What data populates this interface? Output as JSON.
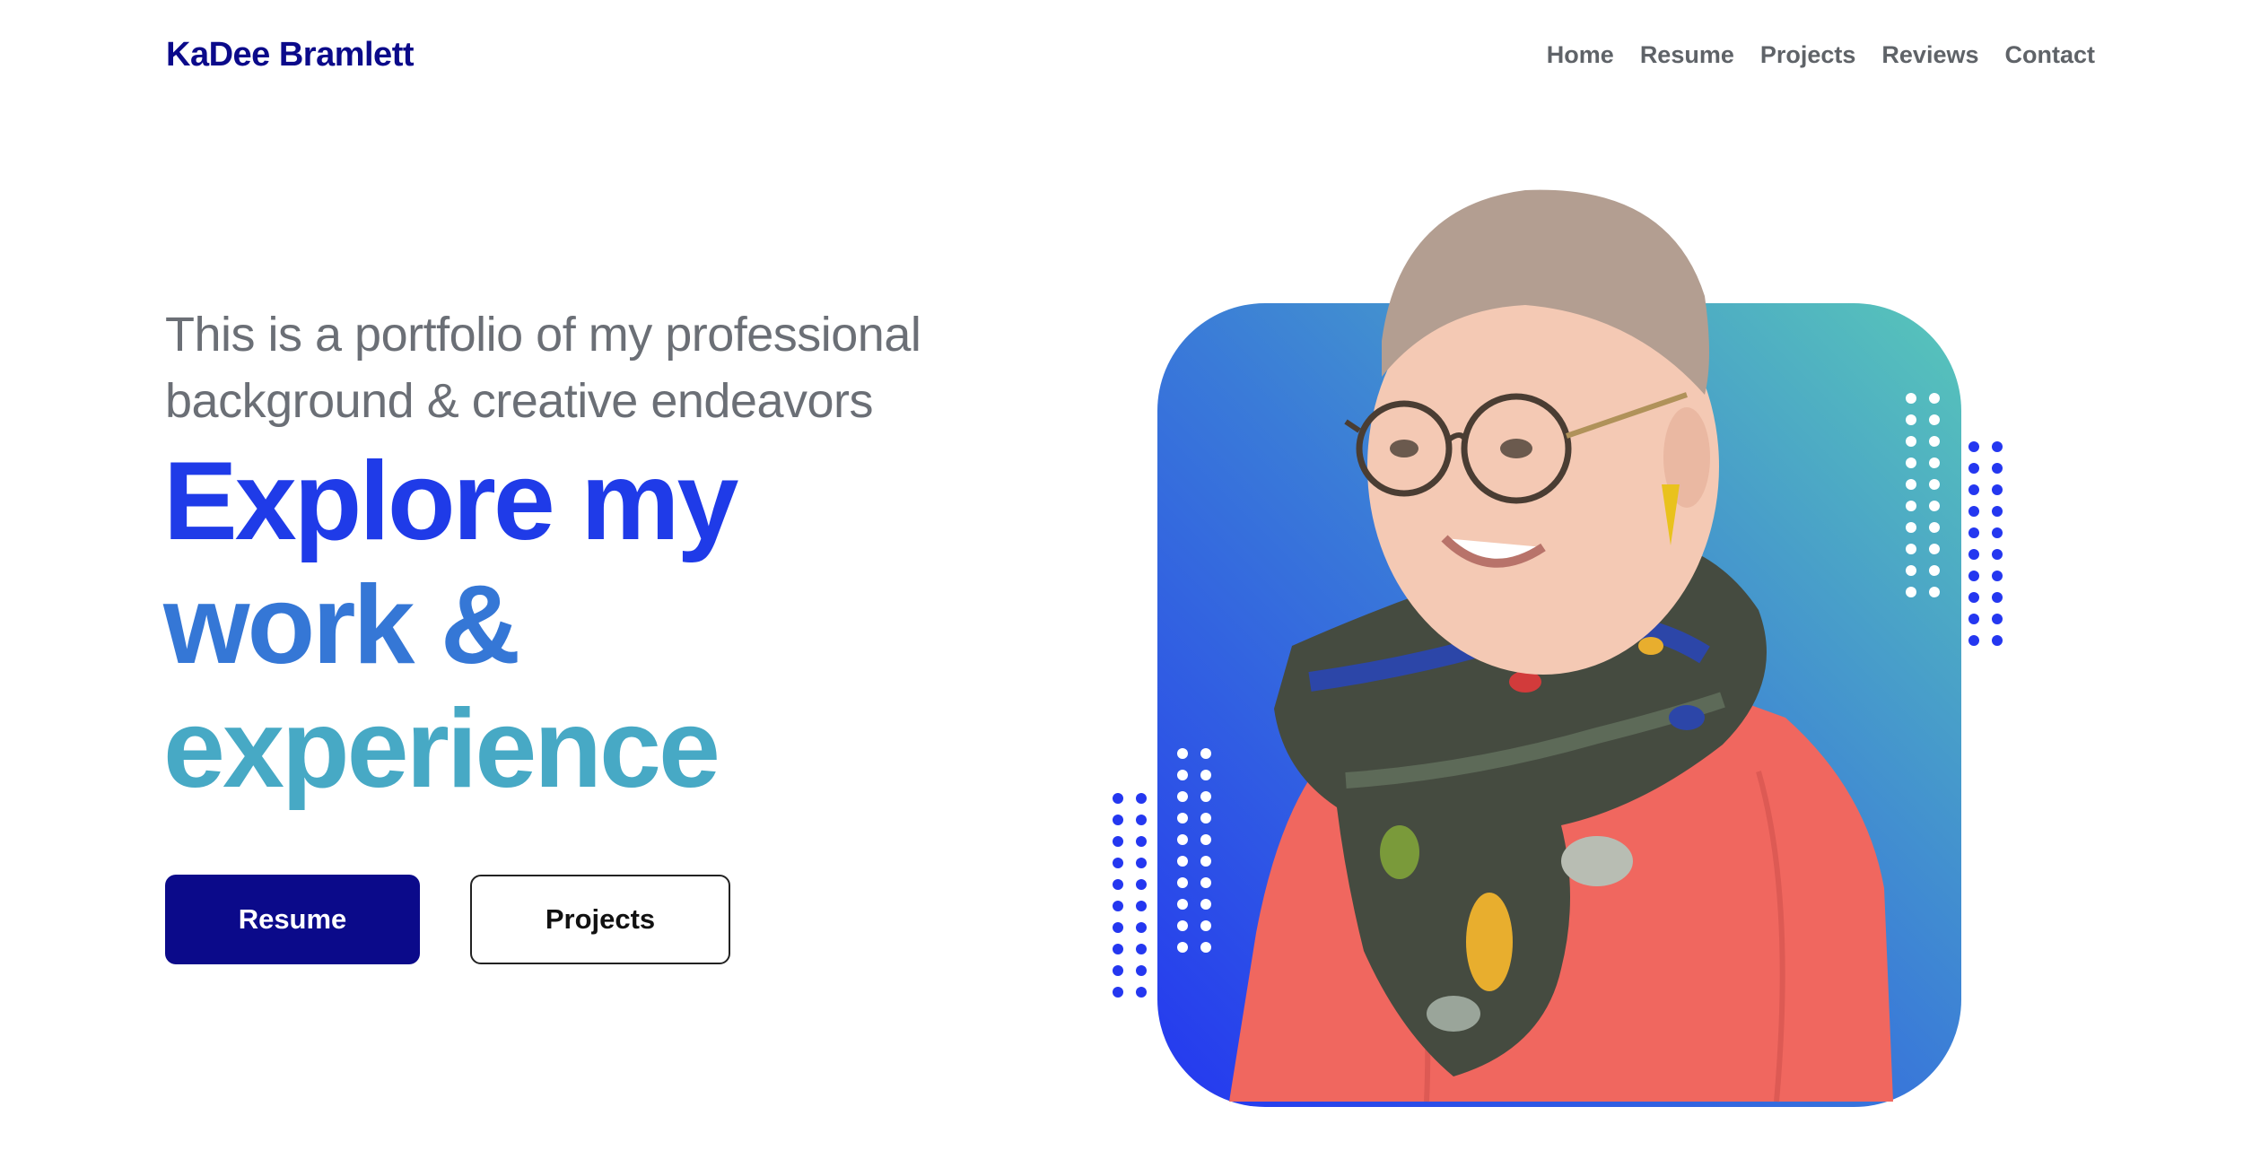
{
  "header": {
    "brand": "KaDee Bramlett",
    "nav": [
      {
        "label": "Home"
      },
      {
        "label": "Resume"
      },
      {
        "label": "Projects"
      },
      {
        "label": "Reviews"
      },
      {
        "label": "Contact"
      }
    ]
  },
  "hero": {
    "intro_line1": "This is a portfolio of my professional",
    "intro_line2": "background & creative endeavors",
    "headline_line1": "Explore my",
    "headline_line2": "work &",
    "headline_line3": "experience",
    "primary_button": "Resume",
    "secondary_button": "Projects"
  },
  "colors": {
    "brand": "#0b0a8a",
    "gradient_start": "#2437f0",
    "gradient_end": "#58c6b9",
    "nav_text": "#5f6368",
    "shirt": "#f0675f"
  }
}
